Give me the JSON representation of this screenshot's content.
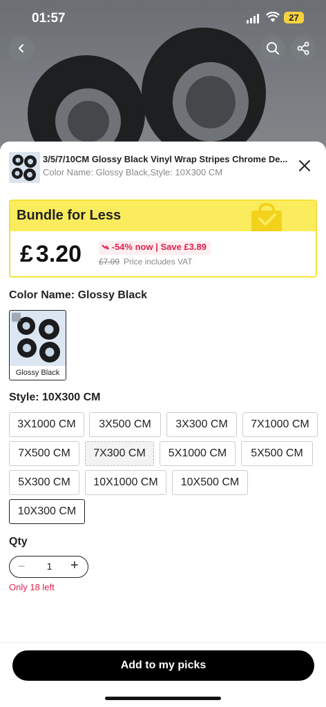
{
  "status": {
    "time": "01:57",
    "battery": "27"
  },
  "product": {
    "title": "3/5/7/10CM Glossy Black Vinyl Wrap Stripes Chrome De...",
    "subtitle": "Color Name: Glossy Black,Style: 10X300 CM"
  },
  "bundle": {
    "title": "Bundle for Less",
    "currency": "£",
    "price": "3.20",
    "discount": "-54% now | Save £3.89",
    "original_price": "£7.09",
    "vat_note": "Price includes VAT"
  },
  "color": {
    "label": "Color Name: Glossy Black",
    "swatch_caption": "Glossy Black"
  },
  "style": {
    "label": "Style: 10X300 CM",
    "options": [
      "3X1000 CM",
      "3X500 CM",
      "3X300 CM",
      "7X1000 CM",
      "7X500 CM",
      "7X300 CM",
      "5X1000 CM",
      "5X500 CM",
      "5X300 CM",
      "10X1000 CM",
      "10X500 CM",
      "10X300 CM"
    ],
    "selected": "10X300 CM",
    "unavailable": "7X300 CM"
  },
  "qty": {
    "label": "Qty",
    "minus": "−",
    "value": "1",
    "plus": "+",
    "stock_note": "Only 18 left"
  },
  "cta": {
    "label": "Add to my picks"
  },
  "colors": {
    "accent_red": "#e0224e",
    "bundle_yellow": "#fbec5d",
    "cta_black": "#000000"
  },
  "icons": [
    "back-arrow-icon",
    "search-icon",
    "share-icon",
    "close-icon",
    "shopping-bag-icon",
    "discount-arrow-icon"
  ]
}
